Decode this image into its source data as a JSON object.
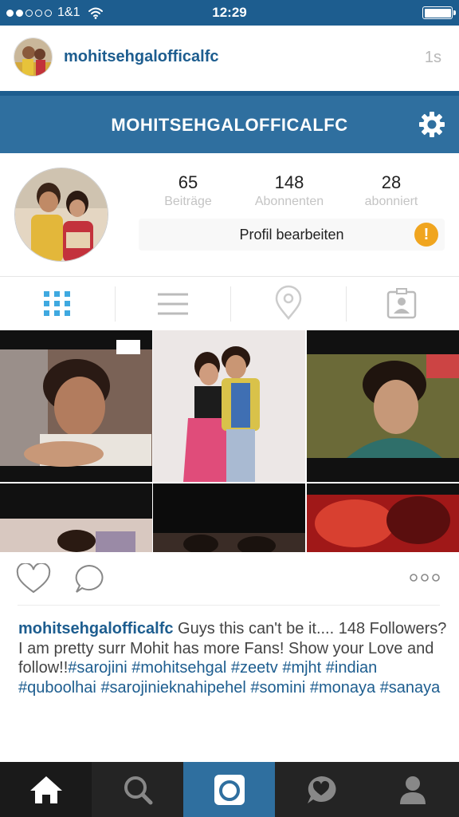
{
  "status_bar": {
    "carrier": "1&1",
    "time": "12:29",
    "signal_dots_filled": 2,
    "signal_dots_total": 5
  },
  "post": {
    "username": "mohitsehgalofficalfc",
    "time_ago": "1s"
  },
  "screenshot": {
    "nav_title": "MOHITSEHGALOFFICALFC",
    "stats": [
      {
        "value": "65",
        "label": "Beiträge"
      },
      {
        "value": "148",
        "label": "Abonnenten"
      },
      {
        "value": "28",
        "label": "abonniert"
      }
    ],
    "edit_profile_label": "Profil bearbeiten",
    "warning_symbol": "!"
  },
  "caption": {
    "username": "mohitsehgalofficalfc",
    "text": " Guys this can't be it.... 148 Followers? I am pretty surr Mohit has more Fans! Show your Love and follow!!",
    "hashtags": [
      "#sarojini",
      "#mohitsehgal",
      "#zeetv",
      "#mjht",
      "#indian",
      "#quboolhai",
      "#sarojinieknahipehel",
      "#somini",
      "#monaya",
      "#sanaya"
    ]
  },
  "icons": {
    "status": [
      "wifi-icon",
      "battery-icon"
    ],
    "nav": [
      "gear-icon"
    ],
    "profile_tabs": [
      "grid-icon",
      "list-icon",
      "location-pin-icon",
      "tagged-person-icon"
    ],
    "actions": [
      "heart-icon",
      "comment-icon",
      "more-dots-icon"
    ],
    "tab_bar": [
      "home-icon",
      "search-icon",
      "camera-icon",
      "activity-icon",
      "profile-icon"
    ]
  },
  "colors": {
    "brand_blue": "#2f6f9f",
    "status_blue": "#1d5d8f",
    "link_blue": "#1d5d8f",
    "warning_orange": "#f0a51f",
    "tabbar_dark": "#1a1a1a"
  }
}
